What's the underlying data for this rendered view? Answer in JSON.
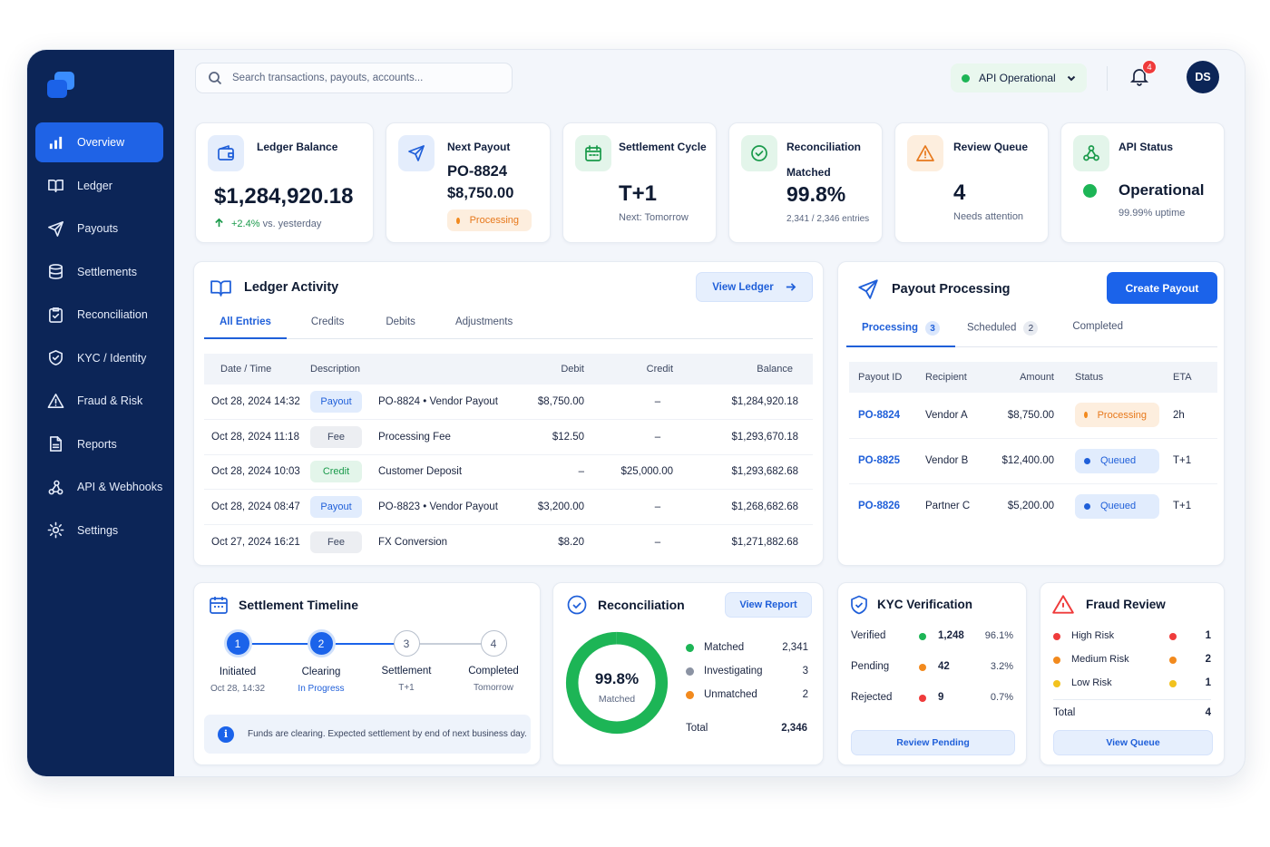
{
  "nav": {
    "items": [
      {
        "label": "Overview",
        "icon": "bar-chart-icon"
      },
      {
        "label": "Ledger",
        "icon": "book-icon"
      },
      {
        "label": "Payouts",
        "icon": "send-icon"
      },
      {
        "label": "Settlements",
        "icon": "database-icon"
      },
      {
        "label": "Reconciliation",
        "icon": "clipboard-check-icon"
      },
      {
        "label": "KYC / Identity",
        "icon": "shield-check-icon"
      },
      {
        "label": "Fraud & Risk",
        "icon": "warning-icon"
      },
      {
        "label": "Reports",
        "icon": "document-icon"
      },
      {
        "label": "API & Webhooks",
        "icon": "webhook-icon"
      },
      {
        "label": "Settings",
        "icon": "gear-icon"
      }
    ]
  },
  "topbar": {
    "search_placeholder": "Search transactions, payouts, accounts...",
    "api_status": "API Operational",
    "notifications": "4",
    "avatar": "DS"
  },
  "kpis": {
    "ledger": {
      "title": "Ledger Balance",
      "value": "$1,284,920.18",
      "delta": "+2.4%",
      "delta_suffix": "vs. yesterday"
    },
    "payout": {
      "title": "Next Payout",
      "id": "PO-8824",
      "amount": "$8,750.00",
      "status": "Processing"
    },
    "settlement": {
      "title": "Settlement Cycle",
      "value": "T+1",
      "sub": "Next: Tomorrow"
    },
    "recon": {
      "title": "Reconciliation",
      "label": "Matched",
      "value": "99.8%",
      "sub": "2,341 / 2,346 entries"
    },
    "review": {
      "title": "Review Queue",
      "value": "4",
      "sub": "Needs attention"
    },
    "api": {
      "title": "API Status",
      "value": "Operational",
      "sub": "99.99% uptime"
    }
  },
  "ledger_activity": {
    "title": "Ledger Activity",
    "button": "View Ledger",
    "tabs": [
      "All Entries",
      "Credits",
      "Debits",
      "Adjustments"
    ],
    "columns": [
      "Date / Time",
      "Description",
      "Debit",
      "Credit",
      "Balance"
    ],
    "rows": [
      {
        "date": "Oct 28, 2024 14:32",
        "type": "Payout",
        "kind": "payout",
        "desc": "PO-8824 • Vendor Payout",
        "debit": "$8,750.00",
        "credit": "–",
        "balance": "$1,284,920.18"
      },
      {
        "date": "Oct 28, 2024 11:18",
        "type": "Fee",
        "kind": "fee",
        "desc": "Processing Fee",
        "debit": "$12.50",
        "credit": "–",
        "balance": "$1,293,670.18"
      },
      {
        "date": "Oct 28, 2024 10:03",
        "type": "Credit",
        "kind": "credit",
        "desc": "Customer Deposit",
        "debit": "–",
        "credit": "$25,000.00",
        "balance": "$1,293,682.68"
      },
      {
        "date": "Oct 28, 2024 08:47",
        "type": "Payout",
        "kind": "payout",
        "desc": "PO-8823 • Vendor Payout",
        "debit": "$3,200.00",
        "credit": "–",
        "balance": "$1,268,682.68"
      },
      {
        "date": "Oct 27, 2024 16:21",
        "type": "Fee",
        "kind": "fee",
        "desc": "FX Conversion",
        "debit": "$8.20",
        "credit": "–",
        "balance": "$1,271,882.68"
      }
    ]
  },
  "payout_processing": {
    "title": "Payout Processing",
    "button": "Create Payout",
    "tabs": [
      {
        "label": "Processing",
        "count": "3"
      },
      {
        "label": "Scheduled",
        "count": "2"
      },
      {
        "label": "Completed",
        "count": ""
      }
    ],
    "columns": [
      "Payout ID",
      "Recipient",
      "Amount",
      "Status",
      "ETA"
    ],
    "rows": [
      {
        "id": "PO-8824",
        "recipient": "Vendor A",
        "amount": "$8,750.00",
        "status": "Processing",
        "kind": "processing",
        "eta": "2h"
      },
      {
        "id": "PO-8825",
        "recipient": "Vendor B",
        "amount": "$12,400.00",
        "status": "Queued",
        "kind": "queued",
        "eta": "T+1"
      },
      {
        "id": "PO-8826",
        "recipient": "Partner C",
        "amount": "$5,200.00",
        "status": "Queued",
        "kind": "queued",
        "eta": "T+1"
      }
    ]
  },
  "settlement_timeline": {
    "title": "Settlement Timeline",
    "steps": [
      {
        "n": "1",
        "label": "Initiated",
        "sub": "Oct 28, 14:32"
      },
      {
        "n": "2",
        "label": "Clearing",
        "sub": "In Progress"
      },
      {
        "n": "3",
        "label": "Settlement",
        "sub": "T+1"
      },
      {
        "n": "4",
        "label": "Completed",
        "sub": "Tomorrow"
      }
    ],
    "note": "Funds are clearing. Expected settlement by end of next business day."
  },
  "reconciliation": {
    "title": "Reconciliation",
    "button": "View Report",
    "donut_value": "99.8%",
    "donut_label": "Matched",
    "matched_fraction": 0.998,
    "legend": [
      {
        "label": "Matched",
        "value": "2,341",
        "color": "#1db556"
      },
      {
        "label": "Investigating",
        "value": "3",
        "color": "#8b93a3"
      },
      {
        "label": "Unmatched",
        "value": "2",
        "color": "#f28a1e"
      }
    ],
    "total_label": "Total",
    "total_value": "2,346"
  },
  "kyc": {
    "title": "KYC Verification",
    "rows": [
      {
        "label": "Verified",
        "count": "1,248",
        "pct": "96.1%",
        "color": "#1db556"
      },
      {
        "label": "Pending",
        "count": "42",
        "pct": "3.2%",
        "color": "#f28a1e"
      },
      {
        "label": "Rejected",
        "count": "9",
        "pct": "0.7%",
        "color": "#ef3b3b"
      }
    ],
    "button": "Review Pending"
  },
  "fraud": {
    "title": "Fraud Review",
    "rows": [
      {
        "label": "High Risk",
        "count": "1",
        "color": "#ef3b3b"
      },
      {
        "label": "Medium Risk",
        "count": "2",
        "color": "#f28a1e"
      },
      {
        "label": "Low Risk",
        "count": "1",
        "color": "#f2c21e"
      }
    ],
    "total_label": "Total",
    "total_value": "4",
    "button": "View Queue"
  }
}
